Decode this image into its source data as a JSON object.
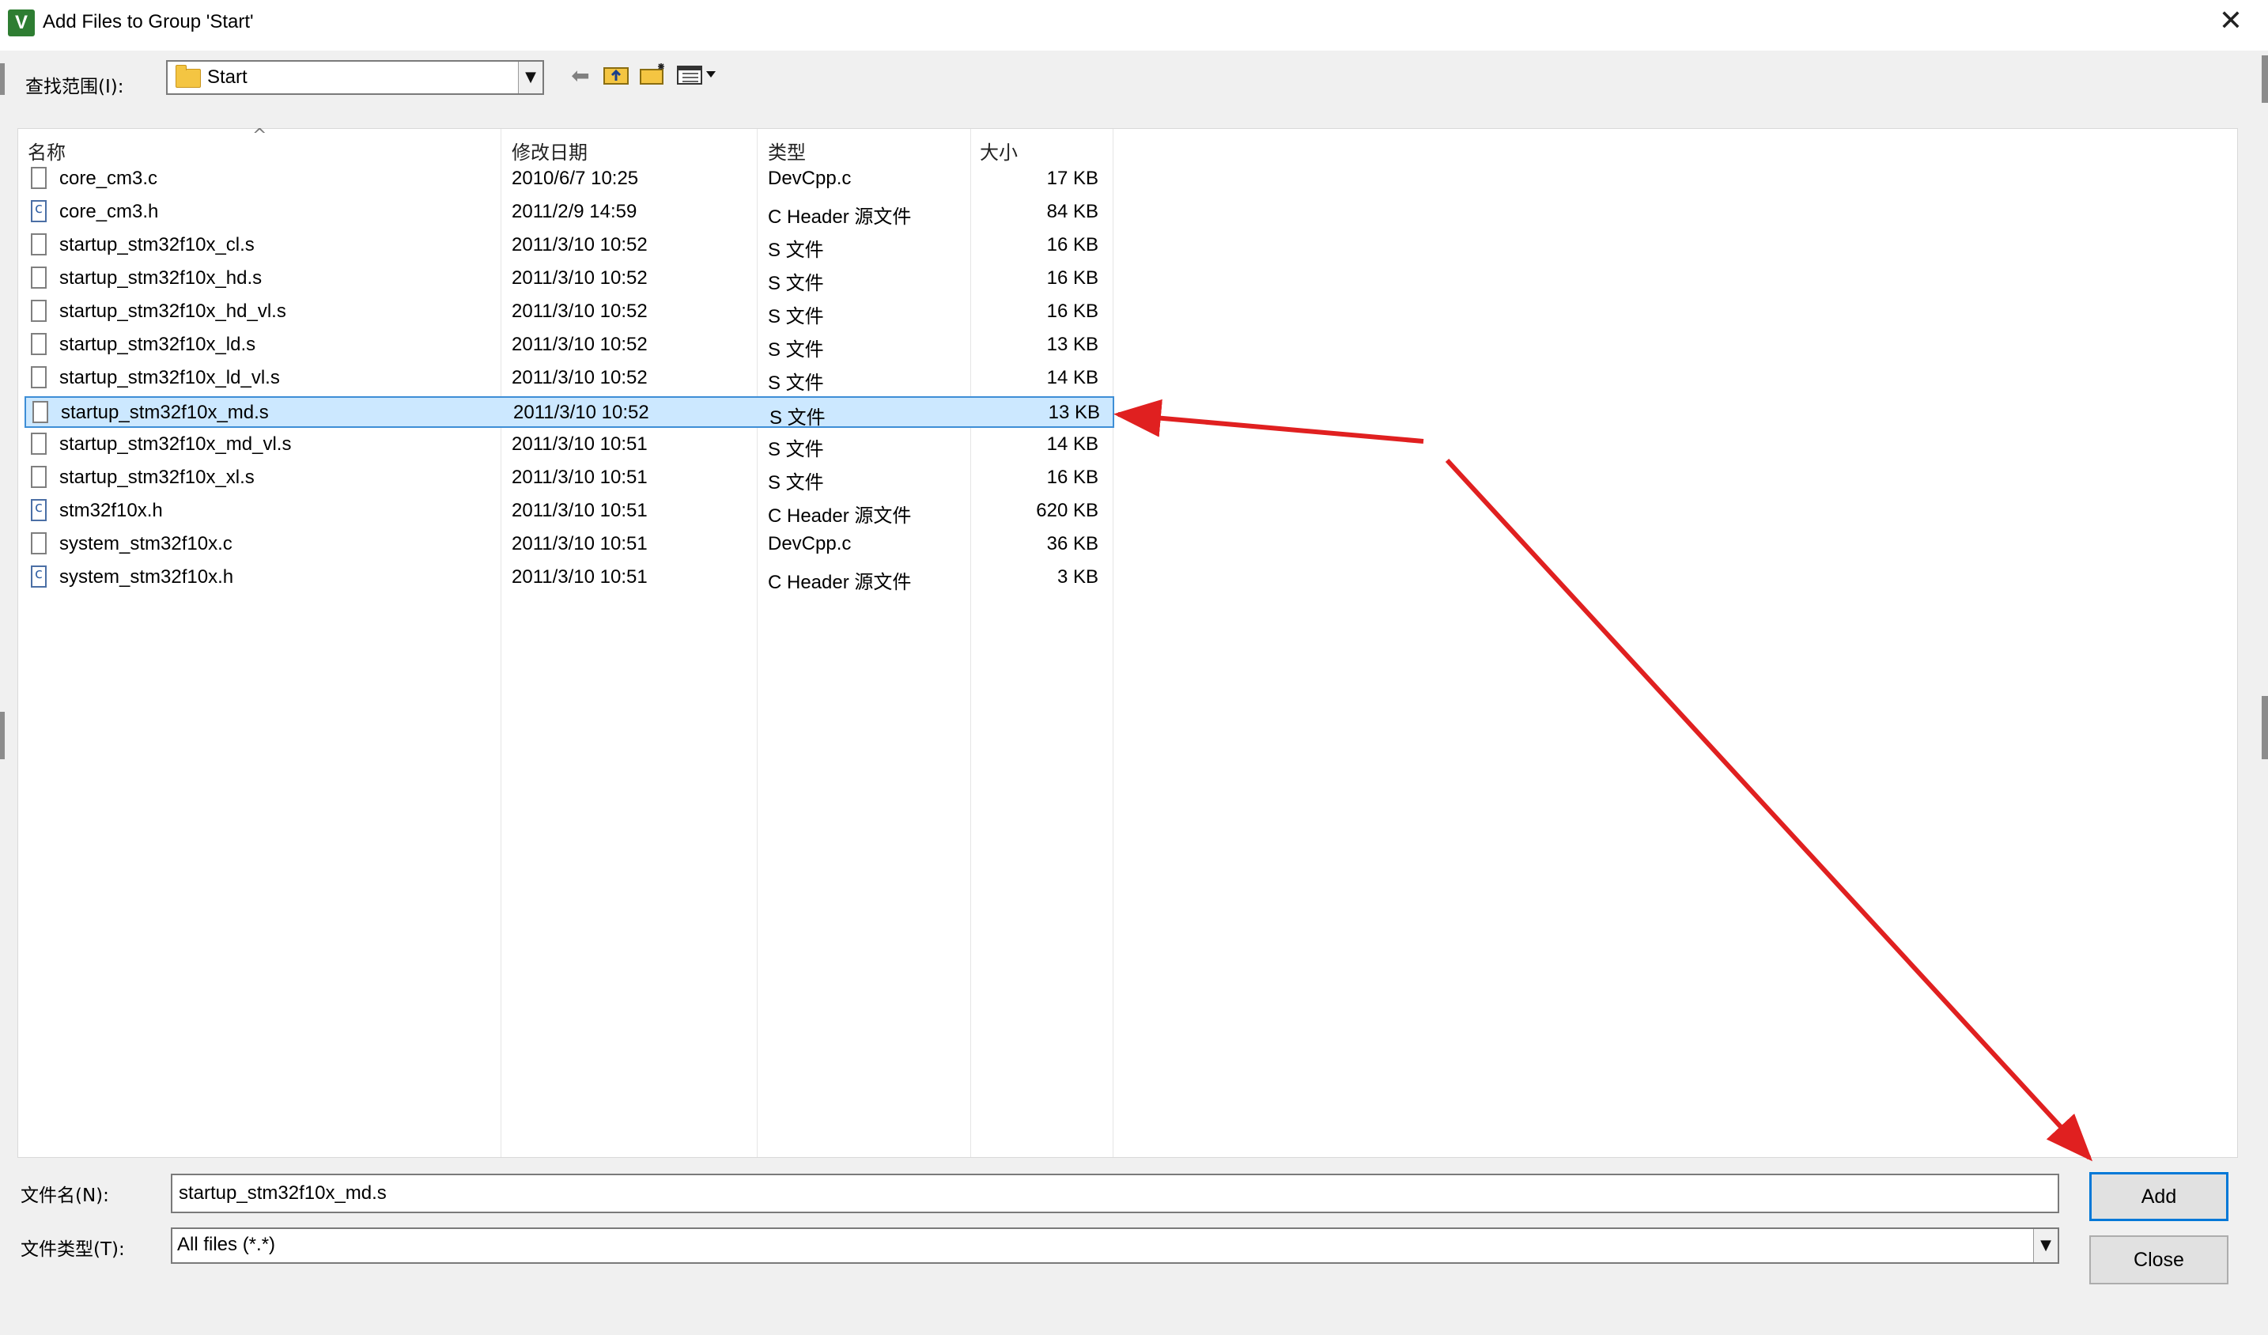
{
  "window": {
    "title": "Add Files to Group 'Start'",
    "icon_text": "V"
  },
  "toolbar": {
    "look_in_label": "查找范围(I):",
    "look_in_value": "Start"
  },
  "columns": {
    "name": "名称",
    "date": "修改日期",
    "type": "类型",
    "size": "大小"
  },
  "files": [
    {
      "name": "core_cm3.c",
      "date": "2010/6/7 10:25",
      "type": "DevCpp.c",
      "size": "17 KB",
      "icon": "file-icon"
    },
    {
      "name": "core_cm3.h",
      "date": "2011/2/9 14:59",
      "type": "C Header 源文件",
      "size": "84 KB",
      "icon": "c-header-file-icon"
    },
    {
      "name": "startup_stm32f10x_cl.s",
      "date": "2011/3/10 10:52",
      "type": "S 文件",
      "size": "16 KB",
      "icon": "file-icon"
    },
    {
      "name": "startup_stm32f10x_hd.s",
      "date": "2011/3/10 10:52",
      "type": "S 文件",
      "size": "16 KB",
      "icon": "file-icon"
    },
    {
      "name": "startup_stm32f10x_hd_vl.s",
      "date": "2011/3/10 10:52",
      "type": "S 文件",
      "size": "16 KB",
      "icon": "file-icon"
    },
    {
      "name": "startup_stm32f10x_ld.s",
      "date": "2011/3/10 10:52",
      "type": "S 文件",
      "size": "13 KB",
      "icon": "file-icon"
    },
    {
      "name": "startup_stm32f10x_ld_vl.s",
      "date": "2011/3/10 10:52",
      "type": "S 文件",
      "size": "14 KB",
      "icon": "file-icon"
    },
    {
      "name": "startup_stm32f10x_md.s",
      "date": "2011/3/10 10:52",
      "type": "S 文件",
      "size": "13 KB",
      "icon": "file-icon",
      "selected": true
    },
    {
      "name": "startup_stm32f10x_md_vl.s",
      "date": "2011/3/10 10:51",
      "type": "S 文件",
      "size": "14 KB",
      "icon": "file-icon"
    },
    {
      "name": "startup_stm32f10x_xl.s",
      "date": "2011/3/10 10:51",
      "type": "S 文件",
      "size": "16 KB",
      "icon": "file-icon"
    },
    {
      "name": "stm32f10x.h",
      "date": "2011/3/10 10:51",
      "type": "C Header 源文件",
      "size": "620 KB",
      "icon": "c-header-file-icon"
    },
    {
      "name": "system_stm32f10x.c",
      "date": "2011/3/10 10:51",
      "type": "DevCpp.c",
      "size": "36 KB",
      "icon": "file-icon"
    },
    {
      "name": "system_stm32f10x.h",
      "date": "2011/3/10 10:51",
      "type": "C Header 源文件",
      "size": "3 KB",
      "icon": "c-header-file-icon"
    }
  ],
  "footer": {
    "filename_label": "文件名(N):",
    "filename_value": "startup_stm32f10x_md.s",
    "filetype_label": "文件类型(T):",
    "filetype_value": "All files (*.*)"
  },
  "buttons": {
    "add": "Add",
    "close": "Close"
  },
  "colors": {
    "selection_fill": "#cce8ff",
    "selection_border": "#3e8ed6",
    "annotation_arrow": "#e02020"
  }
}
